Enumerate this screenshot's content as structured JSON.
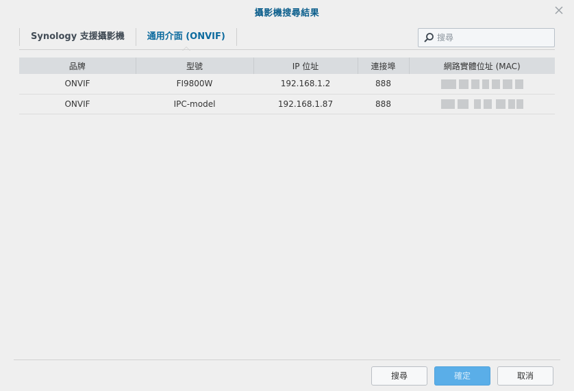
{
  "dialog": {
    "title": "攝影機搜尋結果"
  },
  "tabs": [
    {
      "label": "Synology 支援攝影機",
      "active": false
    },
    {
      "label": "通用介面 (ONVIF)",
      "active": true
    }
  ],
  "search": {
    "placeholder": "搜尋"
  },
  "table": {
    "columns": [
      "品牌",
      "型號",
      "IP 位址",
      "連接埠",
      "網路實體位址 (MAC)"
    ],
    "rows": [
      {
        "brand": "ONVIF",
        "model": "FI9800W",
        "ip": "192.168.1.2",
        "port": "888"
      },
      {
        "brand": "ONVIF",
        "model": "IPC-model",
        "ip": "192.168.1.87",
        "port": "888"
      }
    ]
  },
  "footer": {
    "search_label": "搜尋",
    "ok_label": "確定",
    "cancel_label": "取消"
  },
  "colors": {
    "title": "#0b5e8c",
    "primary_button": "#5aaee8"
  }
}
